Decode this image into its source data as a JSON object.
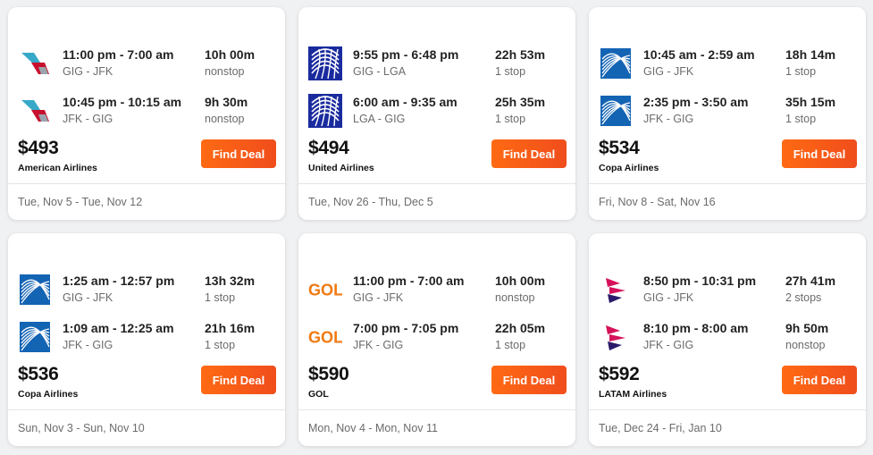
{
  "cards": [
    {
      "legs": [
        {
          "logo": "american-airlines-logo",
          "times": "11:00 pm - 7:00 am",
          "route": "GIG - JFK",
          "duration": "10h 00m",
          "stops": "nonstop"
        },
        {
          "logo": "american-airlines-logo",
          "times": "10:45 pm - 10:15 am",
          "route": "JFK - GIG",
          "duration": "9h 30m",
          "stops": "nonstop"
        }
      ],
      "price": "$493",
      "airline": "American Airlines",
      "button": "Find Deal",
      "dates": "Tue, Nov 5 - Tue, Nov 12"
    },
    {
      "legs": [
        {
          "logo": "united-airlines-logo",
          "times": "9:55 pm - 6:48 pm",
          "route": "GIG - LGA",
          "duration": "22h 53m",
          "stops": "1 stop"
        },
        {
          "logo": "united-airlines-logo",
          "times": "6:00 am - 9:35 am",
          "route": "LGA - GIG",
          "duration": "25h 35m",
          "stops": "1 stop"
        }
      ],
      "price": "$494",
      "airline": "United Airlines",
      "button": "Find Deal",
      "dates": "Tue, Nov 26 - Thu, Dec 5"
    },
    {
      "legs": [
        {
          "logo": "copa-airlines-logo",
          "times": "10:45 am - 2:59 am",
          "route": "GIG - JFK",
          "duration": "18h 14m",
          "stops": "1 stop"
        },
        {
          "logo": "copa-airlines-logo",
          "times": "2:35 pm - 3:50 am",
          "route": "JFK - GIG",
          "duration": "35h 15m",
          "stops": "1 stop"
        }
      ],
      "price": "$534",
      "airline": "Copa Airlines",
      "button": "Find Deal",
      "dates": "Fri, Nov 8 - Sat, Nov 16"
    },
    {
      "legs": [
        {
          "logo": "copa-airlines-logo",
          "times": "1:25 am - 12:57 pm",
          "route": "GIG - JFK",
          "duration": "13h 32m",
          "stops": "1 stop"
        },
        {
          "logo": "copa-airlines-logo",
          "times": "1:09 am - 12:25 am",
          "route": "JFK - GIG",
          "duration": "21h 16m",
          "stops": "1 stop"
        }
      ],
      "price": "$536",
      "airline": "Copa Airlines",
      "button": "Find Deal",
      "dates": "Sun, Nov 3 - Sun, Nov 10"
    },
    {
      "legs": [
        {
          "logo": "gol-logo",
          "logo_text": "GOL",
          "times": "11:00 pm - 7:00 am",
          "route": "GIG - JFK",
          "duration": "10h 00m",
          "stops": "nonstop"
        },
        {
          "logo": "gol-logo",
          "logo_text": "GOL",
          "times": "7:00 pm - 7:05 pm",
          "route": "JFK - GIG",
          "duration": "22h 05m",
          "stops": "1 stop"
        }
      ],
      "price": "$590",
      "airline": "GOL",
      "button": "Find Deal",
      "dates": "Mon, Nov 4 - Mon, Nov 11"
    },
    {
      "legs": [
        {
          "logo": "latam-logo",
          "times": "8:50 pm - 10:31 pm",
          "route": "GIG - JFK",
          "duration": "27h 41m",
          "stops": "2 stops"
        },
        {
          "logo": "latam-logo",
          "times": "8:10 pm - 8:00 am",
          "route": "JFK - GIG",
          "duration": "9h 50m",
          "stops": "nonstop"
        }
      ],
      "price": "$592",
      "airline": "LATAM Airlines",
      "button": "Find Deal",
      "dates": "Tue, Dec 24 - Fri, Jan 10"
    }
  ],
  "colors": {
    "button_start": "#ff6a13",
    "button_end": "#f04d1c",
    "united_blue": "#1a2b9e",
    "copa_blue": "#1464b4",
    "gol_orange": "#f07a12",
    "aa_red": "#c8102e",
    "aa_teal": "#36a9c9",
    "latam_magenta": "#d6115a",
    "latam_indigo": "#2b1a6b"
  }
}
